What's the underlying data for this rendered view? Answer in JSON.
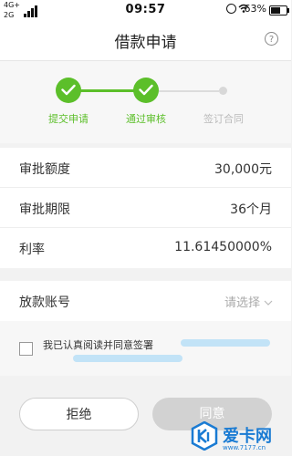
{
  "status_bar": {
    "network_top": "4G+",
    "network_bottom": "2G",
    "time": "09:57",
    "battery": "63%",
    "icons": [
      "signal-icon",
      "alarm-icon",
      "wifi-icon",
      "battery-icon"
    ]
  },
  "header": {
    "title": "借款申请",
    "help_icon": "?"
  },
  "stepper": {
    "steps": [
      {
        "label": "提交申请",
        "status": "done"
      },
      {
        "label": "通过审核",
        "status": "done"
      },
      {
        "label": "签订合同",
        "status": "pending"
      }
    ],
    "active_color": "#5cbf2a",
    "inactive_color": "#bbbbbb"
  },
  "details": [
    {
      "label": "审批额度",
      "value": "30,000元"
    },
    {
      "label": "审批期限",
      "value": "36个月"
    },
    {
      "label": "利率",
      "value": "11.61450000%"
    }
  ],
  "account": {
    "label": "放款账号",
    "placeholder": "请选择"
  },
  "agreement": {
    "text": "我已认真阅读并同意签署",
    "checked": false
  },
  "buttons": {
    "reject": "拒绝",
    "agree": "同意"
  },
  "watermark": {
    "brand": "爱卡网",
    "url": "www.7177.cn"
  }
}
